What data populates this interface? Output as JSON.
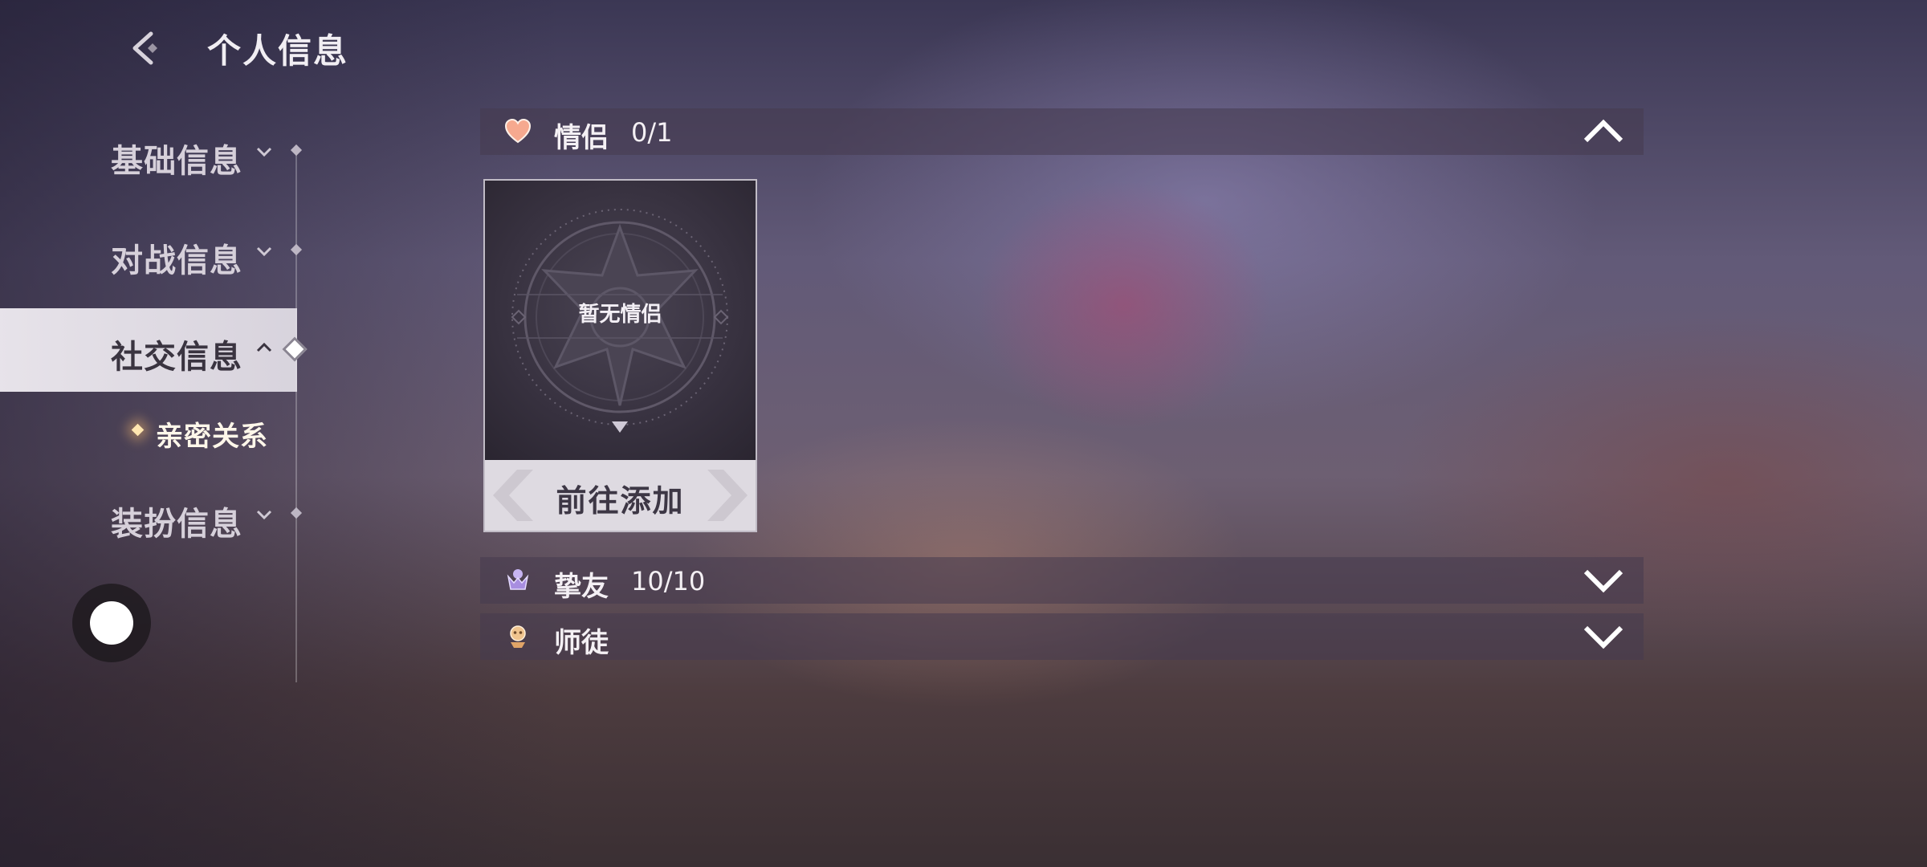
{
  "header": {
    "title": "个人信息"
  },
  "sidebar": {
    "items": [
      {
        "label": "基础信息",
        "state": "collapsed"
      },
      {
        "label": "对战信息",
        "state": "collapsed"
      },
      {
        "label": "社交信息",
        "state": "expanded",
        "active": true
      },
      {
        "label": "装扮信息",
        "state": "collapsed"
      }
    ],
    "sub_items": [
      {
        "label": "亲密关系",
        "active": true
      }
    ]
  },
  "sections": [
    {
      "title": "情侣",
      "count": "0/1",
      "expanded": true,
      "icon": "heart-icon",
      "icon_color": "#f2a48e"
    },
    {
      "title": "挚友",
      "count": "10/10",
      "expanded": false,
      "icon": "friends-icon",
      "icon_color": "#b39ce8"
    },
    {
      "title": "师徒",
      "count": "",
      "expanded": false,
      "icon": "mentor-icon",
      "icon_color": "#e8b07a"
    }
  ],
  "partner_card": {
    "empty_label": "暂无情侣",
    "action_label": "前往添加"
  },
  "colors": {
    "active_nav_bg": "#ece8ee",
    "section_bar_bg": "#463a4e",
    "card_action_bg": "#dedae1"
  }
}
